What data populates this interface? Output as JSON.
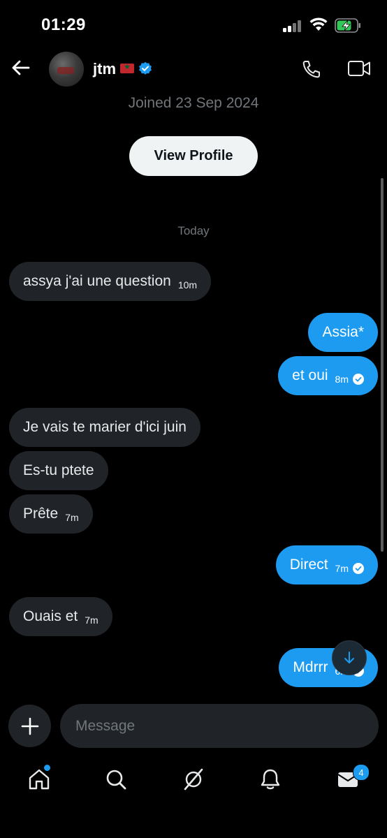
{
  "status_bar": {
    "time": "01:29"
  },
  "header": {
    "username": "jtm",
    "joined": "Joined 23 Sep 2024",
    "view_profile_label": "View Profile"
  },
  "conversation": {
    "day_label": "Today",
    "messages": [
      {
        "text": "assya j'ai une question",
        "time": "10m",
        "direction": "incoming"
      },
      {
        "text": "Assia*",
        "time": "",
        "direction": "outgoing"
      },
      {
        "text": "et oui",
        "time": "8m",
        "direction": "outgoing",
        "read": true
      },
      {
        "text": "Je vais te marier d'ici juin",
        "time": "",
        "direction": "incoming"
      },
      {
        "text": "Es-tu ptete",
        "time": "",
        "direction": "incoming"
      },
      {
        "text": "Prête",
        "time": "7m",
        "direction": "incoming"
      },
      {
        "text": "Direct",
        "time": "7m",
        "direction": "outgoing",
        "read": true
      },
      {
        "text": "Ouais et",
        "time": "7m",
        "direction": "incoming"
      },
      {
        "text": "Mdrrr",
        "time": "6m",
        "direction": "outgoing",
        "read": true
      }
    ]
  },
  "composer": {
    "placeholder": "Message"
  },
  "tabbar": {
    "messages_badge": "4"
  },
  "colors": {
    "accent": "#1d9bf0",
    "incoming_bubble": "#202327",
    "background": "#000000",
    "muted_text": "#71767b"
  },
  "icons": [
    "back-arrow-icon",
    "verified-badge-icon",
    "phone-icon",
    "video-icon",
    "scroll-down-icon",
    "plus-icon",
    "home-icon",
    "search-icon",
    "grok-icon",
    "bell-icon",
    "mail-icon",
    "check-icon"
  ]
}
